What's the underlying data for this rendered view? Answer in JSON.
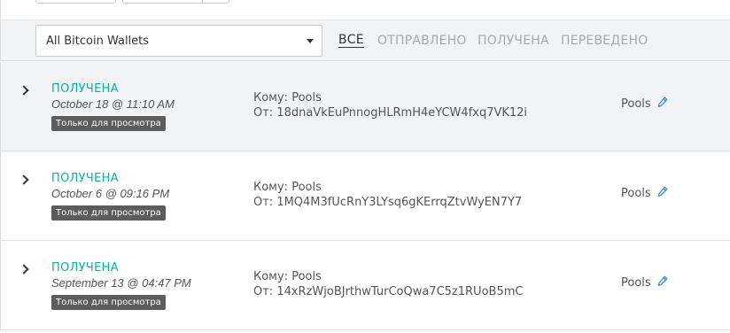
{
  "filters": {
    "wallet_select_value": "All Bitcoin Wallets",
    "tabs": [
      {
        "label": "ВСЕ",
        "active": true
      },
      {
        "label": "ОТПРАВЛЕНО",
        "active": false
      },
      {
        "label": "ПОЛУЧЕНА",
        "active": false
      },
      {
        "label": "ПЕРЕВЕДЕНО",
        "active": false
      }
    ]
  },
  "transactions": [
    {
      "status": "ПОЛУЧЕНА",
      "date": "October 18 @ 11:10 AM",
      "badge": "Только для просмотра",
      "to": "Кому: Pools",
      "from": "От: 18dnaVkEuPnnogHLRmH4eYCW4fxq7VK12i",
      "label": "Pools"
    },
    {
      "status": "ПОЛУЧЕНА",
      "date": "October 6 @ 09:16 PM",
      "badge": "Только для просмотра",
      "to": "Кому: Pools",
      "from": "От: 1MQ4M3fUcRnY3LYsq6gKErrqZtvWyEN7Y7",
      "label": "Pools"
    },
    {
      "status": "ПОЛУЧЕНА",
      "date": "September 13 @ 04:47 PM",
      "badge": "Только для просмотра",
      "to": "Кому: Pools",
      "from": "От: 14xRzWjoBJrthwTurCoQwa7C5z1RUoB5mC",
      "label": "Pools"
    }
  ],
  "colors": {
    "accent_teal": "#10ada4",
    "edit_icon_blue": "#3a8bd8",
    "badge_bg": "#5c5c5c",
    "tab_inactive": "#a7aaad"
  },
  "icons": {
    "expand": "chevron-right-icon",
    "edit": "pencil-icon",
    "dropdown": "caret-down-icon"
  }
}
